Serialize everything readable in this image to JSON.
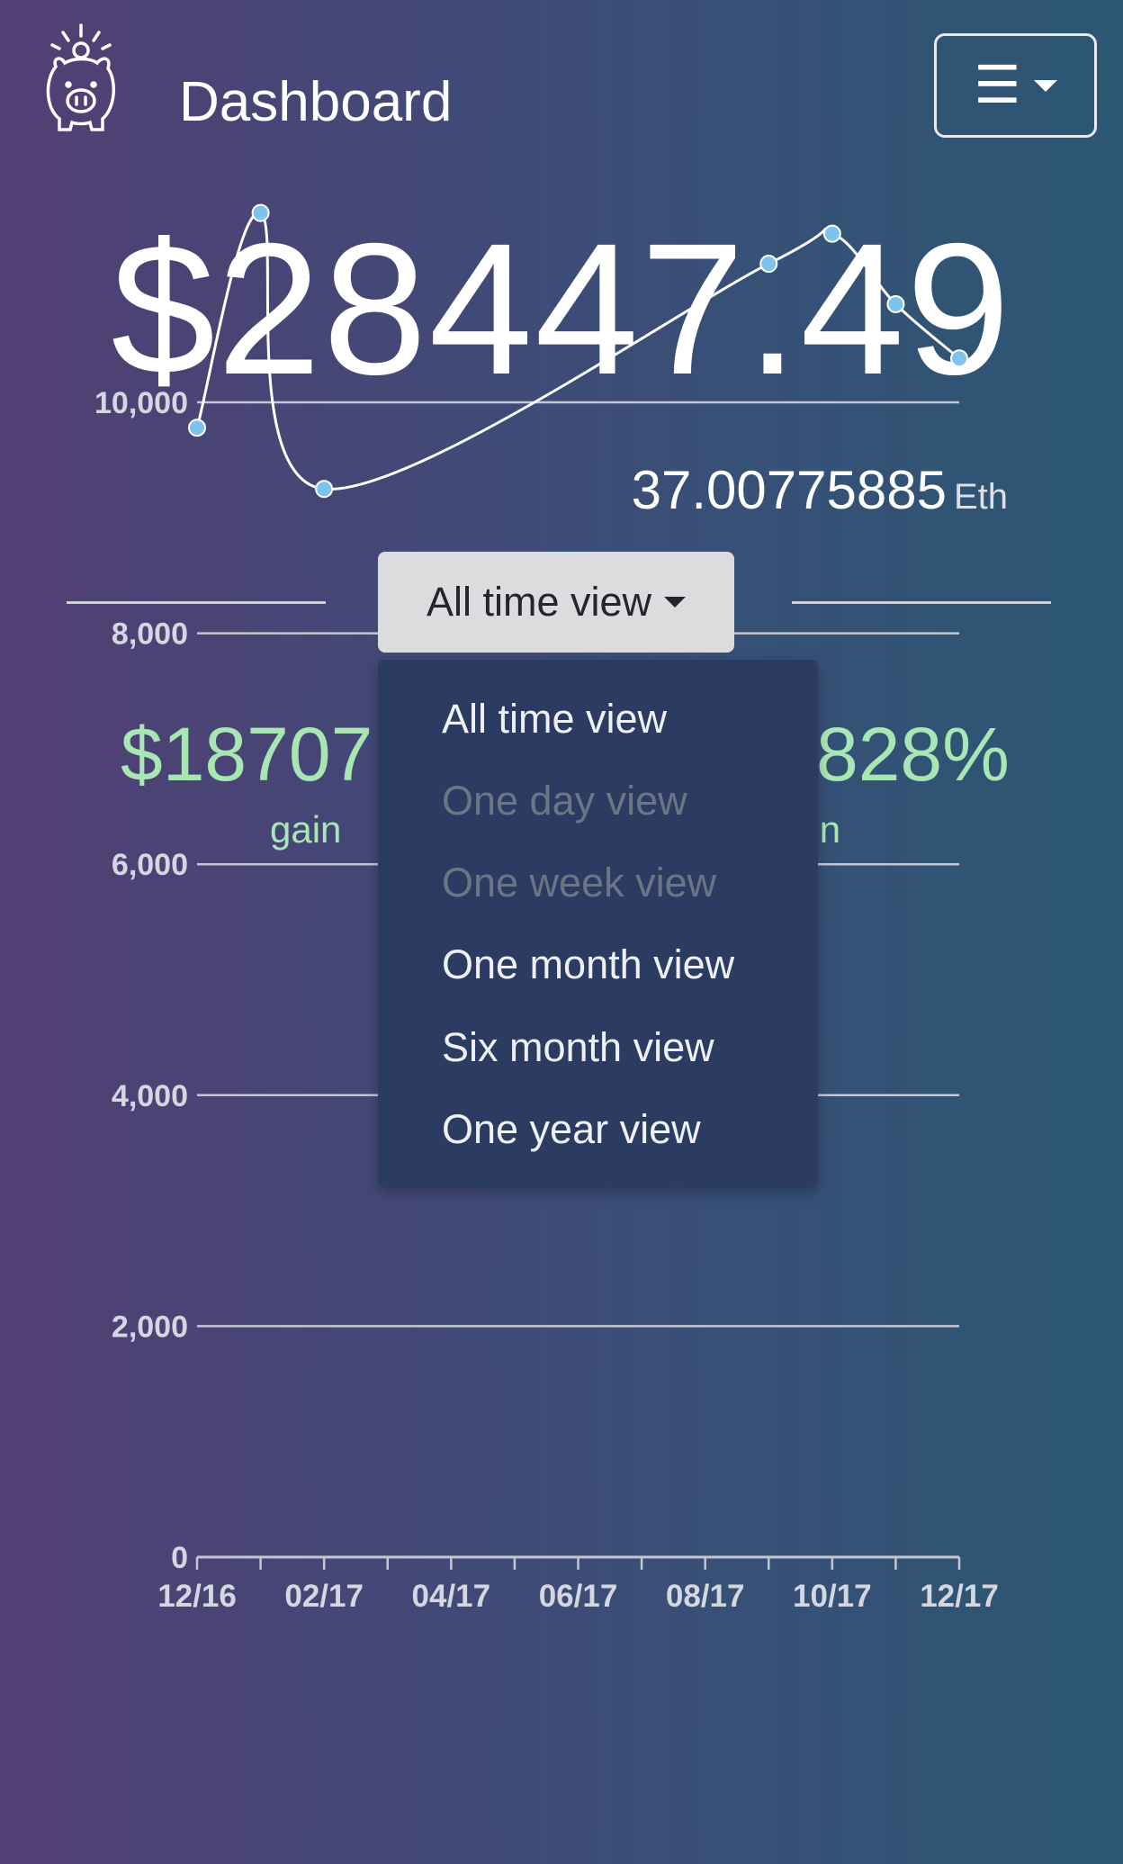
{
  "header": {
    "title": "Dashboard",
    "logo_icon": "piggy-bank-icon",
    "menu_icon": "hamburger-icon"
  },
  "balance": {
    "usd": "$28447.49",
    "eth_value": "37.00775885",
    "eth_unit": "Eth"
  },
  "view_selector": {
    "label": "All time view",
    "options": [
      {
        "label": "All time view",
        "enabled": true
      },
      {
        "label": "One day view",
        "enabled": false
      },
      {
        "label": "One week view",
        "enabled": false
      },
      {
        "label": "One month view",
        "enabled": true
      },
      {
        "label": "Six month view",
        "enabled": true
      },
      {
        "label": "One year view",
        "enabled": true
      }
    ]
  },
  "stats": {
    "gain_amount": "$18707",
    "gain_amount_label": "gain",
    "gain_percent": "828%",
    "gain_percent_label": "ain"
  },
  "colors": {
    "accent_green": "#a8e6b3",
    "point_blue": "#7ec3ee",
    "dropdown_bg": "#2b3b61"
  },
  "chart_data": {
    "type": "line",
    "x_tick_labels": [
      "12/16",
      "02/17",
      "04/17",
      "06/17",
      "08/17",
      "10/17",
      "12/17"
    ],
    "y_tick_labels": [
      "0",
      "2,000",
      "4,000",
      "6,000",
      "8,000",
      "10,000"
    ],
    "ylim": [
      0,
      10000
    ],
    "grid": true,
    "series": [
      {
        "x": [
          "12/16",
          "01/17",
          "02/17",
          "09/17",
          "10/17",
          "11/17",
          "12/17"
        ],
        "values": [
          9780,
          11640,
          9250,
          11200,
          11460,
          10850,
          10380
        ]
      }
    ]
  }
}
